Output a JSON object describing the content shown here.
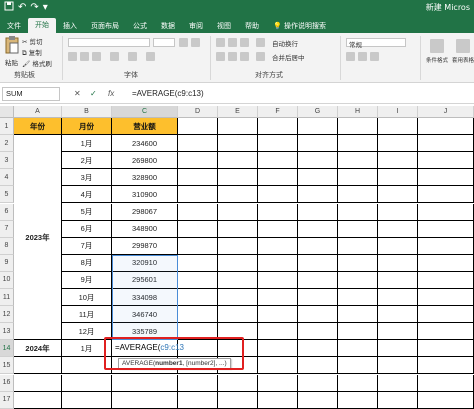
{
  "title_bar": {
    "qat_save_icon": "save-icon",
    "qat_undo": "↶",
    "qat_redo": "↷",
    "qat_more": "▾",
    "window_title": "新建 Micros"
  },
  "tabs": [
    {
      "label": "文件"
    },
    {
      "label": "开始"
    },
    {
      "label": "插入"
    },
    {
      "label": "页面布局"
    },
    {
      "label": "公式"
    },
    {
      "label": "数据"
    },
    {
      "label": "审阅"
    },
    {
      "label": "视图"
    },
    {
      "label": "帮助"
    }
  ],
  "tell_me": "操作说明搜索",
  "ribbon": {
    "clipboard": {
      "paste": "粘贴",
      "cut": "剪切",
      "copy": "复制",
      "format_painter": "格式刷",
      "label": "剪贴板"
    },
    "font": {
      "label": "字体"
    },
    "alignment": {
      "wrap": "自动换行",
      "merge": "合并后居中",
      "label": "对齐方式"
    },
    "number": {
      "label": "常规"
    },
    "styles": {
      "conditional": "条件格式",
      "table": "套用表格格式"
    }
  },
  "formula_bar": {
    "name_box": "SUM",
    "cancel": "✕",
    "enter": "✓",
    "fx": "fx",
    "formula": "=AVERAGE(c9:c13)"
  },
  "columns": [
    "A",
    "B",
    "C",
    "D",
    "E",
    "F",
    "G",
    "H",
    "I",
    "J"
  ],
  "rows": [
    "1",
    "2",
    "3",
    "4",
    "5",
    "6",
    "7",
    "8",
    "9",
    "10",
    "11",
    "12",
    "13",
    "14",
    "15",
    "16",
    "17"
  ],
  "table": {
    "headers": [
      "年份",
      "月份",
      "营业额"
    ],
    "year_2023": "2023年",
    "year_2024": "2024年",
    "months": [
      "1月",
      "2月",
      "3月",
      "4月",
      "5月",
      "6月",
      "7月",
      "8月",
      "9月",
      "10月",
      "11月",
      "12月"
    ],
    "values": [
      "234600",
      "269800",
      "328900",
      "310900",
      "298067",
      "348900",
      "299870",
      "320910",
      "295601",
      "334098",
      "346740",
      "335789"
    ],
    "month_2024": "1月"
  },
  "editing": {
    "prefix": "=AVERAGE(",
    "ref": "c9:c13",
    "suffix": "",
    "tooltip_fn": "AVERAGE(",
    "tooltip_arg1": "number1",
    "tooltip_rest": ", [number2], ...)"
  }
}
